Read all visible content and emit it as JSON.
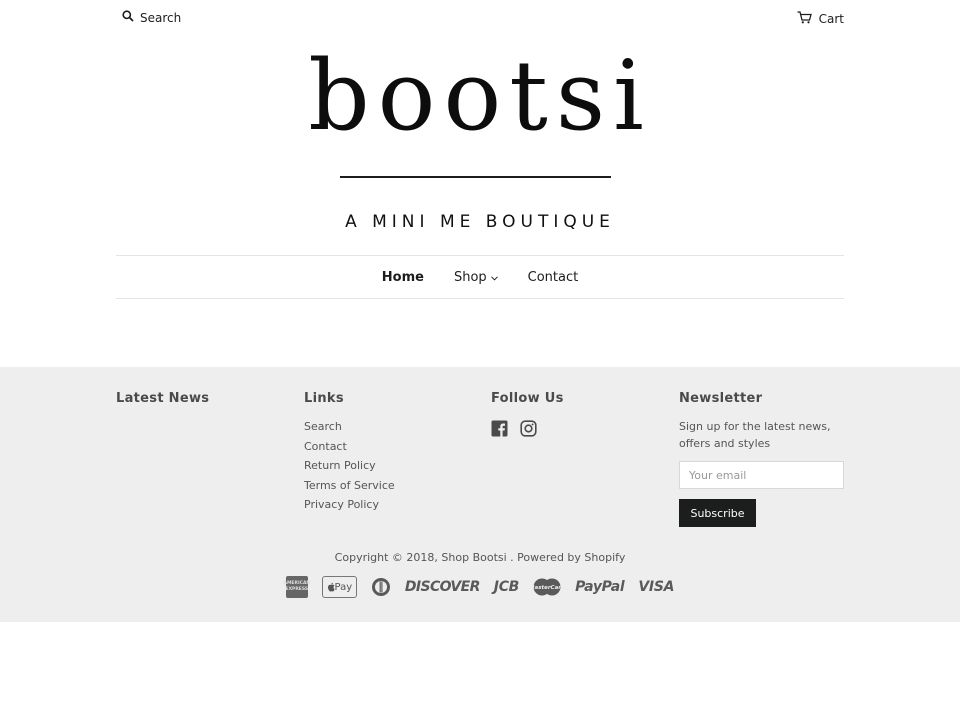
{
  "header": {
    "search_label": "Search",
    "cart_label": "Cart",
    "logo_text": "bootsi",
    "tagline": "A MINI ME BOUTIQUE"
  },
  "nav": {
    "items": [
      {
        "label": "Home",
        "active": true
      },
      {
        "label": "Shop",
        "has_dropdown": true
      },
      {
        "label": "Contact"
      }
    ]
  },
  "footer": {
    "latest_news": {
      "heading": "Latest News"
    },
    "links": {
      "heading": "Links",
      "items": [
        "Search",
        "Contact",
        "Return Policy",
        "Terms of Service",
        "Privacy Policy"
      ]
    },
    "follow": {
      "heading": "Follow Us",
      "icons": [
        "facebook-icon",
        "instagram-icon"
      ]
    },
    "newsletter": {
      "heading": "Newsletter",
      "text": "Sign up for the latest news, offers and styles",
      "email_placeholder": "Your email",
      "subscribe_label": "Subscribe"
    },
    "copyright": "Copyright © 2018, Shop Bootsi . Powered by Shopify",
    "payments": {
      "amex": "AMERICAN EXPRESS",
      "apple_pay": "Pay",
      "diners": "D",
      "discover": "DISCOVER",
      "jcb": "JCB",
      "mastercard": "MasterCard",
      "paypal": "PayPal",
      "visa": "VISA"
    }
  },
  "colors": {
    "text": "#1c1d1d",
    "footer_bg": "#eeeeee",
    "button_bg": "#1c1d1d"
  }
}
